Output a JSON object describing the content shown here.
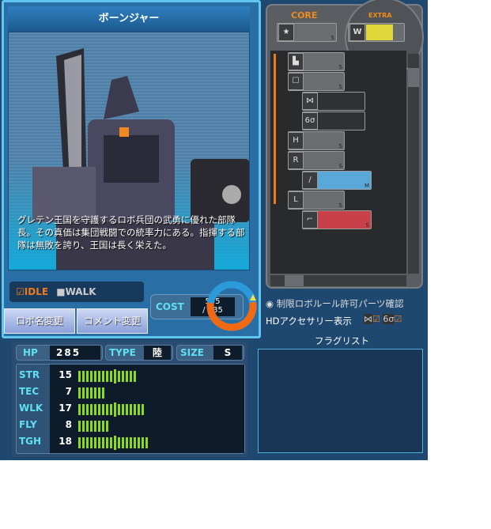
{
  "robot": {
    "name": "ボーンジャー",
    "description": "グレテン王国を守護するロボ兵団の武勇に優れた部隊長。その真価は集団戦闘での統率力にある。指揮する部隊は無敗を誇り、王国は長く栄えた。"
  },
  "mode": {
    "idle": "IDLE",
    "walk": "WALK",
    "idle_checked": true,
    "walk_checked": false
  },
  "buttons": {
    "rename": "ロボ名変更",
    "comment": "コメント変更"
  },
  "cost": {
    "label": "COST",
    "value": "555",
    "max": "/ 635",
    "fraction": 0.874
  },
  "stats": {
    "hp_label": "HP",
    "hp": "285",
    "type_label": "TYPE",
    "type": "陸",
    "size_label": "SIZE",
    "size": "S",
    "rows": [
      {
        "label": "STR",
        "value": "15",
        "n": 15
      },
      {
        "label": "TEC",
        "value": "7",
        "n": 7
      },
      {
        "label": "WLK",
        "value": "17",
        "n": 17
      },
      {
        "label": "FLY",
        "value": "8",
        "n": 8
      },
      {
        "label": "TGH",
        "value": "18",
        "n": 18
      }
    ]
  },
  "parts": {
    "core_label": "CORE",
    "extra_label": "EXTRA",
    "core_size": "S",
    "extra_icon": "W",
    "slots": [
      {
        "icon": "leg-icon",
        "size": "S"
      },
      {
        "icon": "head-icon",
        "size": "S"
      },
      {
        "icon": "accessory-ribbon-icon",
        "size": ""
      },
      {
        "icon": "glasses-icon",
        "size": ""
      },
      {
        "icon": "body-icon",
        "size": "S"
      },
      {
        "icon": "right-arm-icon",
        "size": "S",
        "mark": "R"
      },
      {
        "icon": "sword-icon",
        "size": "M"
      },
      {
        "icon": "left-arm-icon",
        "size": "S",
        "mark": "L"
      },
      {
        "icon": "gun-icon",
        "size": "S"
      }
    ]
  },
  "options": {
    "restricted_check": "制限ロボルール許可パーツ確認",
    "hd_accessory": "HDアクセサリー表示",
    "flag_list": "フラグリスト"
  },
  "colors": {
    "accent_orange": "#f07a1a",
    "cyan": "#5fe0f0",
    "bar_green": "#8fd81a"
  }
}
